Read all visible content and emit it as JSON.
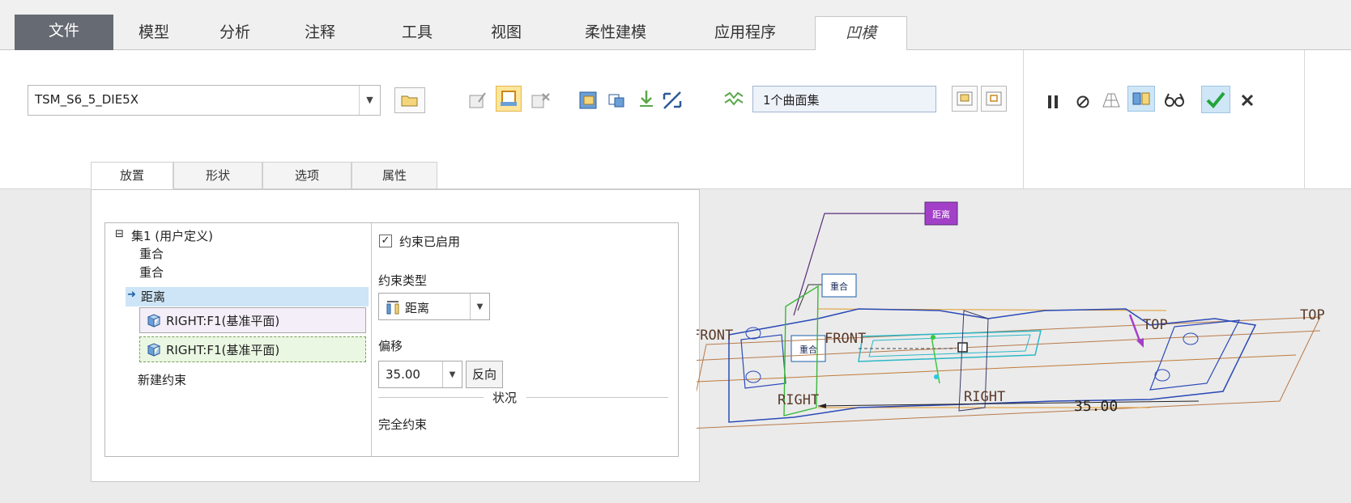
{
  "ribbon_tabs": [
    "文件",
    "模型",
    "分析",
    "注释",
    "工具",
    "视图",
    "柔性建模",
    "应用程序",
    "凹模"
  ],
  "toolbar": {
    "component_name": "TSM_S6_5_DIE5X",
    "surface_collector": "1个曲面集"
  },
  "sub_tabs": [
    "放置",
    "形状",
    "选项",
    "属性"
  ],
  "tree": {
    "set_label": "集1 (用户定义)",
    "expand_glyph": "⊟",
    "items": [
      "重合",
      "重合",
      "距离"
    ],
    "references": [
      "RIGHT:F1(基准平面)",
      "RIGHT:F1(基准平面)"
    ],
    "new_constraint": "新建约束"
  },
  "constraint": {
    "enabled_label": "约束已启用",
    "type_label": "约束类型",
    "type_value": "距离",
    "offset_label": "偏移",
    "offset_value": "35.00",
    "flip_label": "反向",
    "status_label": "状况",
    "status_value": "完全约束"
  },
  "graphics": {
    "tag_distance": "距离",
    "tag_coincident_1": "重合",
    "tag_coincident_2": "重合",
    "plane_front_left": "FRONT",
    "plane_front_mid": "FRONT",
    "plane_top_right": "TOP",
    "plane_top_mid": "TOP",
    "plane_right_left": "RIGHT",
    "plane_right_mid": "RIGHT",
    "dimension": "35.00"
  },
  "colors": {
    "accent_check": "#22a53a",
    "distance_tag": "#a340c8",
    "selection": "#cde5f7"
  }
}
